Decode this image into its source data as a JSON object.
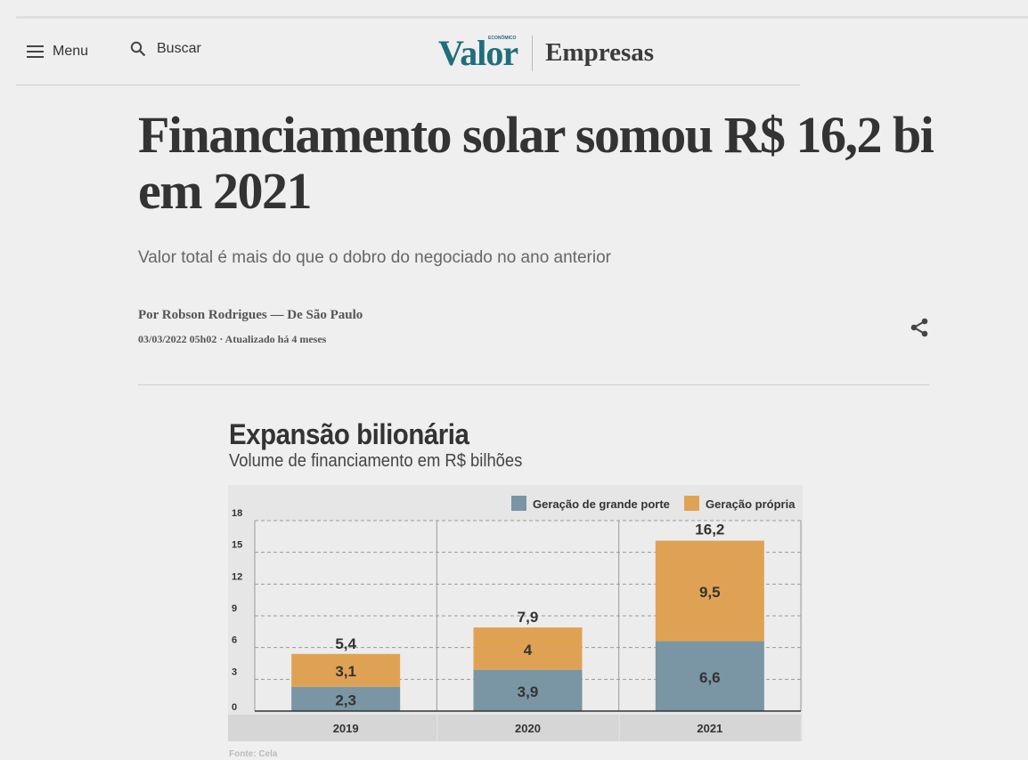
{
  "header": {
    "menu_label": "Menu",
    "search_label": "Buscar",
    "logo_text": "Valor",
    "logo_small_text": "ECONÔMICO",
    "section": "Empresas"
  },
  "article": {
    "headline": "Financiamento solar somou R$ 16,2 bi em 2021",
    "subhead": "Valor total é mais do que o dobro do negociado no ano anterior",
    "byline": "Por Robson Rodrigues — De São Paulo",
    "dateline": "03/03/2022 05h02 · Atualizado há 4 meses"
  },
  "figure": {
    "title": "Expansão bilionária",
    "subtitle": "Volume de financiamento em R$ bilhões",
    "source": "Fonte: Cela"
  },
  "chart_data": {
    "type": "bar",
    "stacked": true,
    "categories": [
      "2019",
      "2020",
      "2021"
    ],
    "series": [
      {
        "name": "Geração de grande porte",
        "color": "#7a95a3",
        "values": [
          2.3,
          3.9,
          6.6
        ],
        "labels": [
          "2,3",
          "3,9",
          "6,6"
        ]
      },
      {
        "name": "Geração própria",
        "color": "#dfa254",
        "values": [
          3.1,
          4.0,
          9.5
        ],
        "labels": [
          "3,1",
          "4",
          "9,5"
        ]
      }
    ],
    "totals": [
      5.4,
      7.9,
      16.2
    ],
    "total_labels": [
      "5,4",
      "7,9",
      "16,2"
    ],
    "ylim": [
      0,
      18
    ],
    "yticks": [
      "0",
      "3",
      "6",
      "9",
      "12",
      "15",
      "18"
    ],
    "grid": true,
    "legend_position": "top-right"
  }
}
